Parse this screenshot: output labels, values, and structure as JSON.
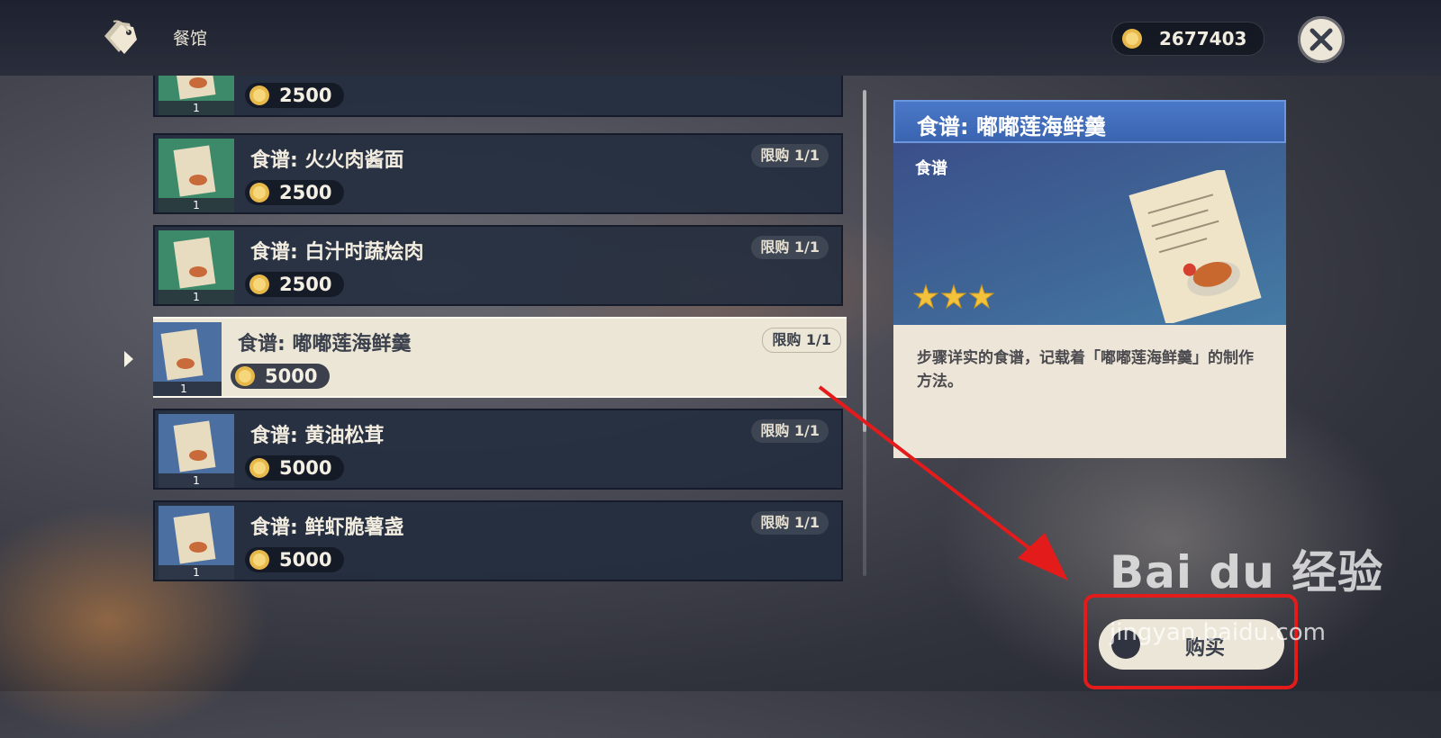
{
  "header": {
    "shop_title": "餐馆",
    "currency_amount": "2677403"
  },
  "list": {
    "items": [
      {
        "name": "",
        "price": "2500",
        "limit": "",
        "count": "1",
        "color": "green"
      },
      {
        "name": "食谱: 火火肉酱面",
        "price": "2500",
        "limit": "限购 1/1",
        "count": "1",
        "color": "green"
      },
      {
        "name": "食谱: 白汁时蔬烩肉",
        "price": "2500",
        "limit": "限购 1/1",
        "count": "1",
        "color": "green"
      },
      {
        "name": "食谱: 嘟嘟莲海鲜羹",
        "price": "5000",
        "limit": "限购 1/1",
        "count": "1",
        "color": "blue",
        "selected": true
      },
      {
        "name": "食谱: 黄油松茸",
        "price": "5000",
        "limit": "限购 1/1",
        "count": "1",
        "color": "blue"
      },
      {
        "name": "食谱: 鲜虾脆薯盏",
        "price": "5000",
        "limit": "限购 1/1",
        "count": "1",
        "color": "blue"
      }
    ]
  },
  "detail": {
    "title": "食谱: 嘟嘟莲海鲜羹",
    "type": "食谱",
    "rarity_stars": 3,
    "description": "步骤详实的食谱，记载着「嘟嘟莲海鲜羹」的制作方法。"
  },
  "buy_button": {
    "label": "购买"
  },
  "watermark": {
    "brand": "Bai du 经验",
    "url": "jingyan.baidu.com"
  },
  "colors": {
    "annotation": "#e41b1b",
    "header_blue": "#3a64b0",
    "panel_cream": "#ece6d8"
  }
}
